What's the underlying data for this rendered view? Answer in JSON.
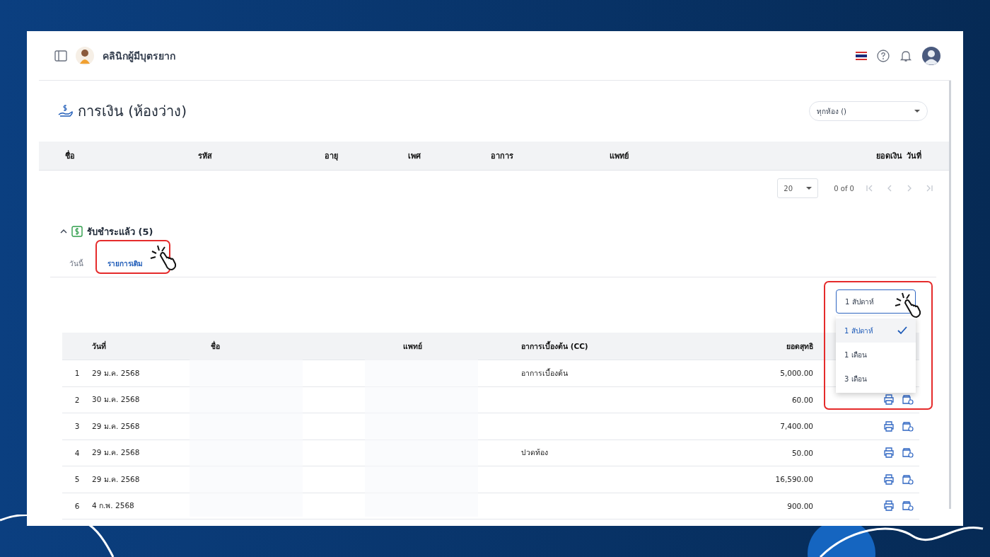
{
  "app": {
    "name": "คลินิกผู้มีบุตรยาก"
  },
  "page": {
    "title": "การเงิน (ห้องว่าง)",
    "room_select": {
      "value": "ทุกห้อง ()"
    }
  },
  "pending_table": {
    "columns": [
      "ชื่อ",
      "รหัส",
      "อายุ",
      "เพศ",
      "อาการ",
      "แพทย์",
      "ยอดเงิน",
      "วันที่"
    ]
  },
  "pagination": {
    "page_size": "20",
    "range": "0 of 0"
  },
  "paid_section": {
    "title": "รับชำระแล้ว (5)",
    "expanded": true
  },
  "tabs": [
    {
      "label": "วันนี้",
      "selected": false
    },
    {
      "label": "รายการเดิม",
      "selected": true
    }
  ],
  "period_select": {
    "value": "1 สัปดาห์",
    "open": true,
    "options": [
      {
        "label": "1 สัปดาห์",
        "selected": true
      },
      {
        "label": "1 เดือน",
        "selected": false
      },
      {
        "label": "3 เดือน",
        "selected": false
      }
    ]
  },
  "paid_table": {
    "columns": [
      "วันที่",
      "ชื่อ",
      "แพทย์",
      "อาการเบื้องต้น (CC)",
      "ยอดสุทธิ"
    ],
    "rows": [
      {
        "index": "1",
        "date": "29 ม.ค. 2568",
        "cc": "อาการเบื้องต้น",
        "net": "5,000.00"
      },
      {
        "index": "2",
        "date": "30 ม.ค. 2568",
        "cc": "",
        "net": "60.00"
      },
      {
        "index": "3",
        "date": "29 ม.ค. 2568",
        "cc": "",
        "net": "7,400.00"
      },
      {
        "index": "4",
        "date": "29 ม.ค. 2568",
        "cc": "ปวดท้อง",
        "net": "50.00"
      },
      {
        "index": "5",
        "date": "29 ม.ค. 2568",
        "cc": "",
        "net": "16,590.00"
      },
      {
        "index": "6",
        "date": "4 ก.พ. 2568",
        "cc": "",
        "net": "900.00"
      }
    ]
  }
}
